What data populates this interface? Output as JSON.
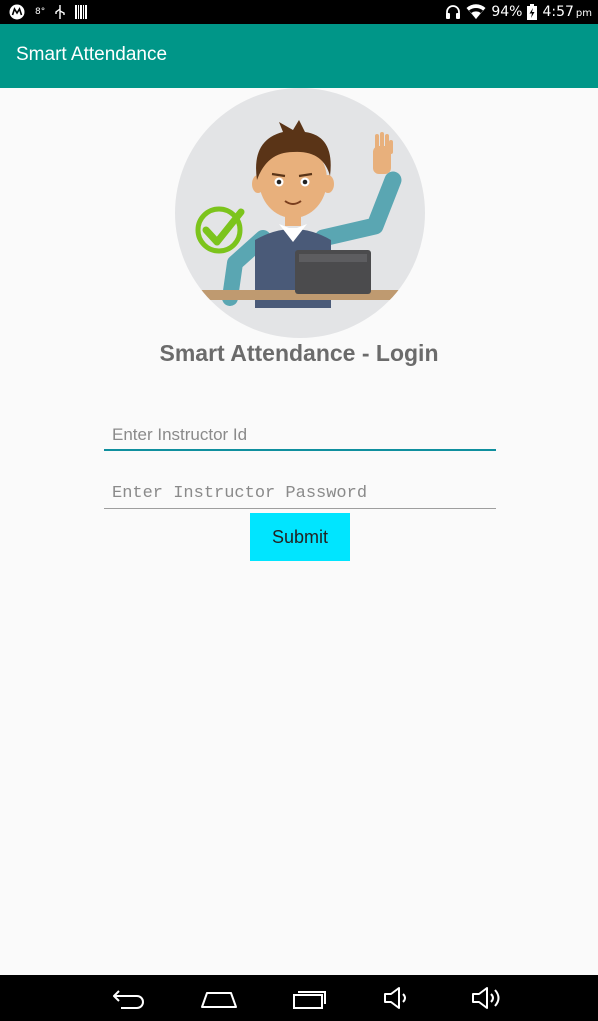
{
  "status_bar": {
    "left_icons": [
      "motorola-icon",
      "temperature-icon",
      "usb-icon",
      "barcode-icon"
    ],
    "temperature": "8°",
    "battery_percent": "94%",
    "time": "4:57",
    "ampm": "pm"
  },
  "app_bar": {
    "title": "Smart Attendance"
  },
  "login": {
    "title": "Smart Attendance - Login",
    "instructor_id": {
      "placeholder": "Enter Instructor Id",
      "value": ""
    },
    "instructor_password": {
      "placeholder": "Enter Instructor Password",
      "value": ""
    },
    "submit_label": "Submit"
  },
  "nav_bar": {
    "buttons": [
      "back-icon",
      "home-icon",
      "recents-icon",
      "volume-down-icon",
      "volume-up-icon"
    ]
  },
  "colors": {
    "app_bar": "#009688",
    "accent_underline": "#0f8f9e",
    "submit_button": "#00e5ff",
    "title_text": "#6b6b6b",
    "background": "#fafafa"
  }
}
